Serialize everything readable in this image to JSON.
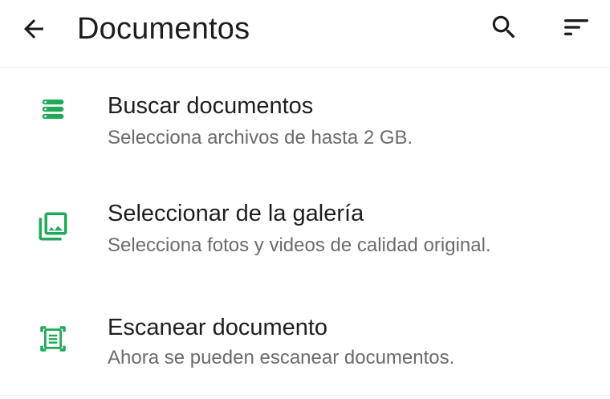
{
  "header": {
    "title": "Documentos"
  },
  "icons": {
    "back": "arrow-back-icon",
    "search": "search-icon",
    "sort": "sort-icon"
  },
  "colors": {
    "accent": "#1faa59",
    "title_text": "#1e1e1e",
    "subtitle_text": "#6b6b6b"
  },
  "items": [
    {
      "title": "Buscar documentos",
      "subtitle": "Selecciona archivos de hasta 2 GB.",
      "icon": "storage-icon"
    },
    {
      "title": "Seleccionar de la galería",
      "subtitle": "Selecciona fotos y videos de calidad original.",
      "icon": "gallery-icon"
    },
    {
      "title": "Escanear documento",
      "subtitle": "Ahora se pueden escanear documentos.",
      "icon": "document-scanner-icon"
    }
  ]
}
